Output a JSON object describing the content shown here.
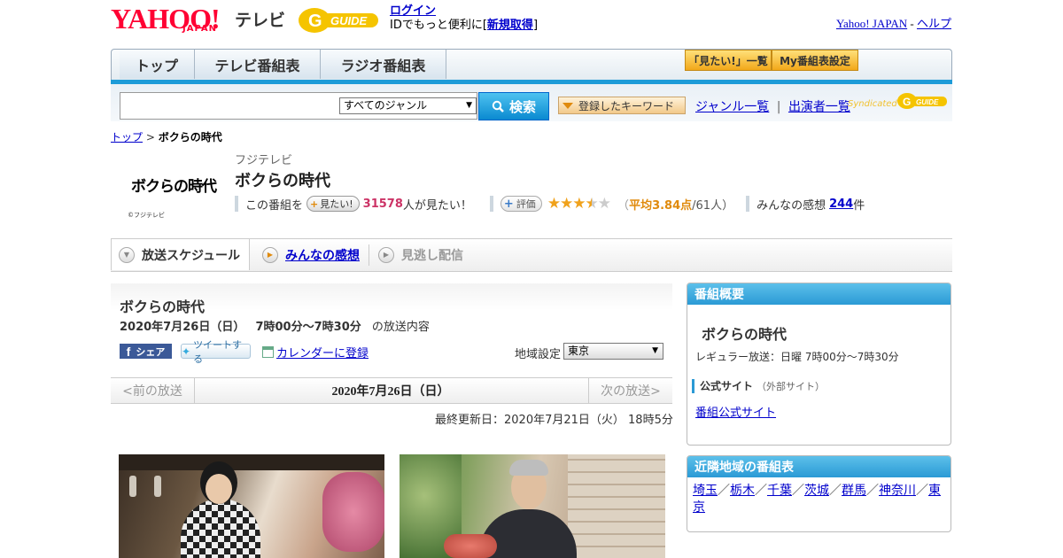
{
  "header": {
    "yahoo_logo": "YAHOO!",
    "japan_logo": "JAPAN",
    "tv_label": "テレビ",
    "gguide_logo": "G-GUIDE",
    "login_link": "ログイン",
    "login_text": "IDでもっと便利に[",
    "signup_link": "新規取得",
    "login_close": "]",
    "yahoo_japan_link": "Yahoo! JAPAN",
    "dash": "-",
    "help_link": "ヘルプ"
  },
  "nav": {
    "tabs": [
      "トップ",
      "テレビ番組表",
      "ラジオ番組表"
    ],
    "mitai_list_btn": "「見たい!」一覧",
    "my_schedule_btn": "My番組表設定"
  },
  "search": {
    "input_value": "",
    "genre_select": "すべてのジャンル",
    "search_btn": "検索",
    "keyword_btn": "登録したキーワード",
    "genre_list_link": "ジャンル一覧",
    "separator": "|",
    "performer_list_link": "出演者一覧",
    "syndicated": "Syndicated"
  },
  "breadcrumb": {
    "top_link": "トップ",
    "sep": ">",
    "current": "ボクらの時代"
  },
  "program": {
    "logo_text": "ボクらの時代",
    "copyright": "©フジテレビ",
    "station": "フジテレビ",
    "title": "ボクらの時代",
    "this_program": "この番組を",
    "mitai_btn": "見たい!",
    "mitai_count": "31578",
    "mitai_suffix": "人が見たい！",
    "rate_btn": "評価",
    "stars_full": "★★★",
    "stars_half": "★",
    "stars_empty": "★",
    "avg_open": "（",
    "avg_label": "平均3.84点",
    "avg_count": "/61人）",
    "impressions_label": "みんなの感想",
    "impressions_count": "244",
    "impressions_suffix": "件",
    "rating_value": 3.84
  },
  "content_tabs": [
    "放送スケジュール",
    "みんなの感想",
    "見逃し配信"
  ],
  "broadcast": {
    "title": "ボクらの時代",
    "date": "2020年7月26日（日）",
    "time": "7時00分～7時30分",
    "suffix": "の放送内容",
    "fb_label": "シェア",
    "tw_label": "ツイートする",
    "calendar_link": "カレンダーに登録",
    "region_label": "地域設定",
    "region_value": "東京",
    "prev": "<前の放送",
    "pager_date": "2020年7月26日（日）",
    "next": "次の放送>",
    "updated": "最終更新日：2020年7月21日（火） 18時5分"
  },
  "sidebar": {
    "overview_head": "番組概要",
    "overview_title": "ボクらの時代",
    "regular": "レギュラー放送：日曜 7時00分～7時30分",
    "official_label": "公式サイト",
    "official_sub": "（外部サイト）",
    "official_link": "番組公式サイト",
    "nearby_head": "近隣地域の番組表",
    "regions": [
      "埼玉",
      "栃木",
      "千葉",
      "茨城",
      "群馬",
      "神奈川",
      "東京"
    ],
    "region_sep": "／"
  },
  "colors": {
    "accent_blue": "#1d9bd8",
    "yahoo_red": "#ff0033",
    "star_orange": "#f0a21c",
    "pink": "#cc3366"
  }
}
